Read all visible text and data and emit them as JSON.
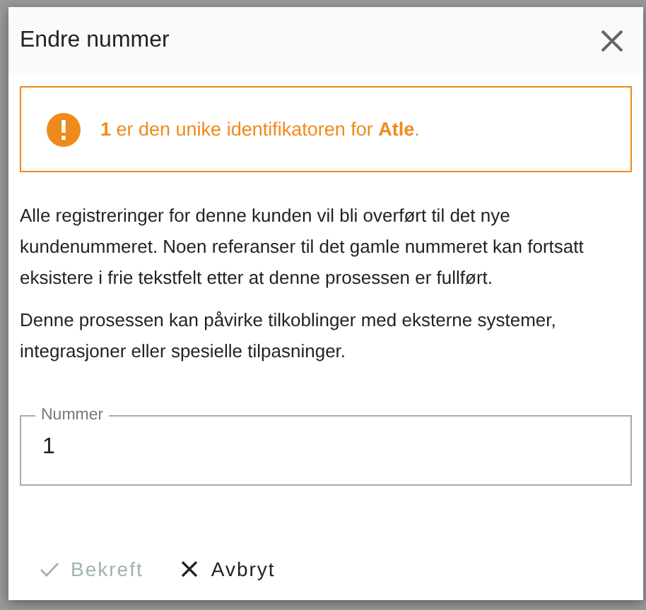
{
  "dialog": {
    "title": "Endre nummer",
    "alert": {
      "text": "**1** er den unike identifikatoren for **Atle**."
    },
    "paragraphs": [
      "Alle registreringer for denne kunden vil bli overført til det nye kundenummeret. Noen referanser til det gamle nummeret kan fortsatt eksistere i frie tekstfelt etter at denne prosessen er fullført.",
      "Denne prosessen kan påvirke tilkoblinger med eksterne systemer, integrasjoner eller spesielle tilpasninger."
    ],
    "field": {
      "label": "Nummer",
      "value": "1"
    },
    "buttons": [
      {
        "label": "Bekreft",
        "kind": "check",
        "disabled": true
      },
      {
        "label": "Avbryt",
        "kind": "close",
        "disabled": false
      }
    ]
  }
}
